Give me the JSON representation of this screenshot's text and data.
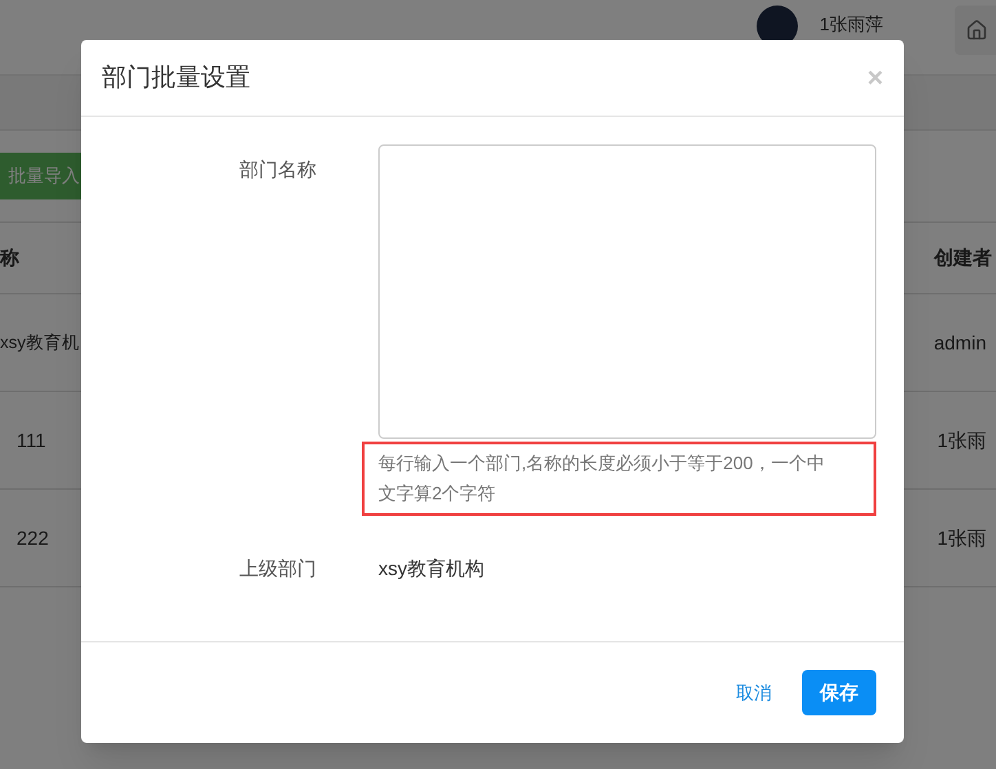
{
  "header": {
    "user_name": "1张雨萍"
  },
  "toolbar": {
    "import_button": "批量导入"
  },
  "table": {
    "columns": [
      "称",
      "创建者"
    ],
    "rows": [
      {
        "column_1": "xsy教育机",
        "creator": "admin"
      },
      {
        "column_1": "111",
        "creator": "1张雨"
      },
      {
        "column_1": "222",
        "creator": "1张雨"
      }
    ]
  },
  "dialog": {
    "title": "部门批量设置",
    "close": "×",
    "fields": [
      {
        "label": "部门名称",
        "kind": "textarea",
        "hint": "每行输入一个部门,名称的长度必须小于等于200，一个中文字算2个字符",
        "highlighted": true
      },
      {
        "label": "上级部门",
        "kind": "static",
        "value": "xsy教育机构"
      }
    ],
    "buttons": [
      {
        "label": "取消",
        "kind": "link"
      },
      {
        "label": "保存",
        "kind": "primary"
      }
    ]
  }
}
